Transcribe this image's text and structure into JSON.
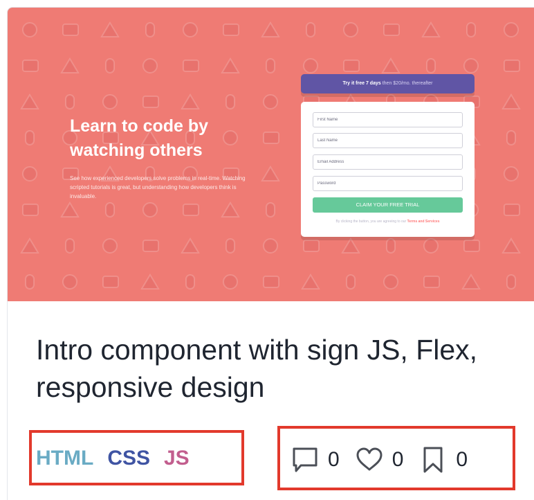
{
  "preview": {
    "headline": "Learn to code by watching others",
    "description": "See how experienced developers solve problems in real-time. Watching scripted tutorials is great, but understanding how developers think is invaluable.",
    "trial_bold": "Try it free 7 days",
    "trial_rest": "then $20/mo. thereafter",
    "fields": {
      "first_name": "First Name",
      "last_name": "Last Name",
      "email": "Email Address",
      "password": "Password"
    },
    "claim_button": "CLAIM YOUR FREE TRIAL",
    "terms_text": "By clicking the button, you are agreeing to our",
    "terms_link": "Terms and Services"
  },
  "card": {
    "title": "Intro component with sign JS, Flex, responsive design",
    "tags": [
      "HTML",
      "CSS",
      "JS"
    ],
    "stats": {
      "comments": "0",
      "likes": "0",
      "bookmarks": "0"
    }
  },
  "colors": {
    "preview_bg": "#ef7b74",
    "trial_banner": "#6055a5",
    "claim_button": "#66c99a",
    "tag_html": "#6aabc4",
    "tag_css": "#3f54a3",
    "tag_js": "#c25e8e",
    "highlight": "#e2392c"
  }
}
